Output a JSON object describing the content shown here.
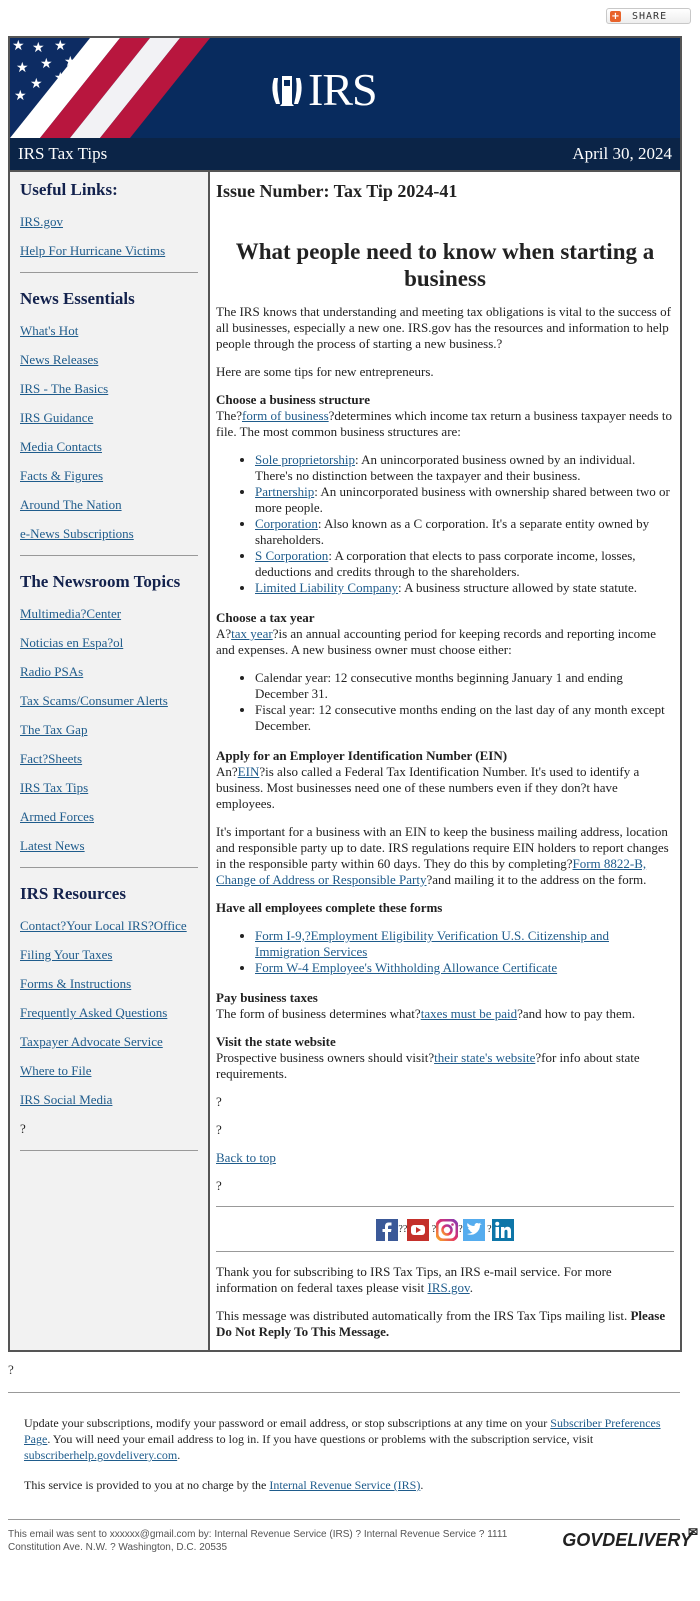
{
  "share": {
    "label": "SHARE",
    "icon": "plus-icon"
  },
  "banner": {
    "logo_text": "IRS",
    "logo_icon": "irs-eagle-icon",
    "colors": {
      "navy": "#082b5e",
      "red": "#b8163e",
      "white": "#ffffff"
    }
  },
  "titlebar": {
    "left": "IRS Tax Tips",
    "right": "April 30, 2024"
  },
  "sidebar": {
    "sections": [
      {
        "title": "Useful Links:",
        "items": [
          "IRS.gov",
          "Help For Hurricane Victims"
        ]
      },
      {
        "title": "News Essentials",
        "items": [
          "What's Hot",
          "News Releases",
          "IRS - The Basics",
          "IRS Guidance",
          "Media Contacts",
          "Facts & Figures",
          "Around The Nation",
          "e-News Subscriptions"
        ]
      },
      {
        "title": "The Newsroom Topics",
        "items": [
          "Multimedia?Center",
          "Noticias en Espa?ol",
          "Radio PSAs",
          "Tax Scams/Consumer Alerts",
          "The Tax Gap",
          "Fact?Sheets",
          "IRS Tax Tips",
          "Armed Forces",
          "Latest News"
        ]
      },
      {
        "title": "IRS Resources",
        "items": [
          "Contact?Your Local IRS?Office",
          "Filing Your Taxes",
          "Forms & Instructions",
          "Frequently Asked Questions",
          "Taxpayer Advocate Service",
          "Where to File",
          "IRS Social Media"
        ],
        "trailing": "?"
      }
    ]
  },
  "content": {
    "issue": "Issue Number: Tax Tip 2024-41",
    "headline": "What people need to know when starting a business",
    "intro": "The IRS knows that understanding and meeting tax obligations is vital to the success of all businesses, especially a new one. IRS.gov has the resources and information to help people through the process of starting a new business.?",
    "tips_intro": "Here are some tips for new entrepreneurs.",
    "structure": {
      "heading": "Choose a business structure",
      "pre": "The?",
      "link": "form of business",
      "post": "?determines which income tax return a business taxpayer needs to file. The most common business structures are:",
      "items": [
        {
          "link": "Sole proprietorship",
          "text": ": An unincorporated business owned by an individual. There's no distinction between the taxpayer and their business."
        },
        {
          "link": "Partnership",
          "text": ": An unincorporated business with ownership shared between two or more people."
        },
        {
          "link": "Corporation",
          "text": ": Also known as a C corporation. It's a separate entity owned by shareholders."
        },
        {
          "link": "S Corporation",
          "text": ": A corporation that elects to pass corporate income, losses, deductions and credits through to the shareholders."
        },
        {
          "link": "Limited Liability Company",
          "text": ": A business structure allowed by state statute."
        }
      ]
    },
    "taxyear": {
      "heading": "Choose a tax year",
      "pre": "A?",
      "link": "tax year",
      "post": "?is an annual accounting period for keeping records and reporting income and expenses. A new business owner must choose either:",
      "items": [
        "Calendar year: 12 consecutive months beginning January 1 and ending December 31.",
        "Fiscal year: 12 consecutive months ending on the last day of any month except December."
      ]
    },
    "ein": {
      "heading": "Apply for an Employer Identification Number (EIN)",
      "pre": "An?",
      "link": "EIN",
      "post": "?is also called a Federal Tax Identification Number. It's used to identify a business. Most businesses need one of these numbers even if they don?t have employees.",
      "p2_pre": "It's important for a business with an EIN to keep the business mailing address, location and responsible party up to date. IRS regulations require EIN holders to report changes in the responsible party within 60 days. They do this by completing?",
      "p2_link": "Form 8822-B, Change of Address or Responsible Party",
      "p2_post": "?and mailing it to the address on the form."
    },
    "employees": {
      "heading": "Have all employees complete these forms",
      "items": [
        "Form I-9,?Employment Eligibility Verification U.S. Citizenship and Immigration Services",
        "Form W-4 Employee's Withholding Allowance Certificate"
      ]
    },
    "paytaxes": {
      "heading": "Pay business taxes",
      "pre": "The form of business determines what?",
      "link": "taxes must be paid",
      "post": "?and how to pay them."
    },
    "state": {
      "heading": "Visit the state website",
      "pre": "Prospective business owners should visit?",
      "link": "their state's website",
      "post": "?for info about state requirements."
    },
    "q1": "?",
    "q2": "?",
    "back_to_top": "Back to top",
    "q3": "?",
    "social": [
      {
        "icon": "facebook-icon",
        "after": "??"
      },
      {
        "icon": "youtube-icon",
        "after": " ?"
      },
      {
        "icon": "instagram-icon",
        "after": "?"
      },
      {
        "icon": "twitter-icon",
        "after": " ?"
      },
      {
        "icon": "linkedin-icon",
        "after": ""
      }
    ],
    "thanks_pre": "Thank you for subscribing to IRS Tax Tips, an IRS e-mail service. For more information on federal taxes please visit ",
    "thanks_link": "IRS.gov",
    "thanks_post": ".",
    "auto_pre": "This message was distributed automatically from the IRS Tax Tips mailing list. ",
    "auto_bold": "Please Do Not Reply To This Message."
  },
  "after_q": "?",
  "subscription": {
    "p1_pre": "Update your subscriptions, modify your password or email address, or stop subscriptions at any time on your ",
    "p1_link": "Subscriber Preferences Page",
    "p1_mid": ". You will need your email address to log in. If you have questions or problems with the subscription service, visit ",
    "p1_link2": "subscriberhelp.govdelivery.com",
    "p1_post": ".",
    "p2_pre": "This service is provided to you at no charge by the ",
    "p2_link": "Internal Revenue Service (IRS)",
    "p2_post": "."
  },
  "footer": {
    "address": "This email was sent to xxxxxx@gmail.com by: Internal Revenue Service (IRS) ? Internal Revenue Service ? 1111 Constitution Ave. N.W. ? Washington, D.C. 20535",
    "brand": "GOVDELIVERY",
    "brand_icon": "envelope-icon"
  }
}
